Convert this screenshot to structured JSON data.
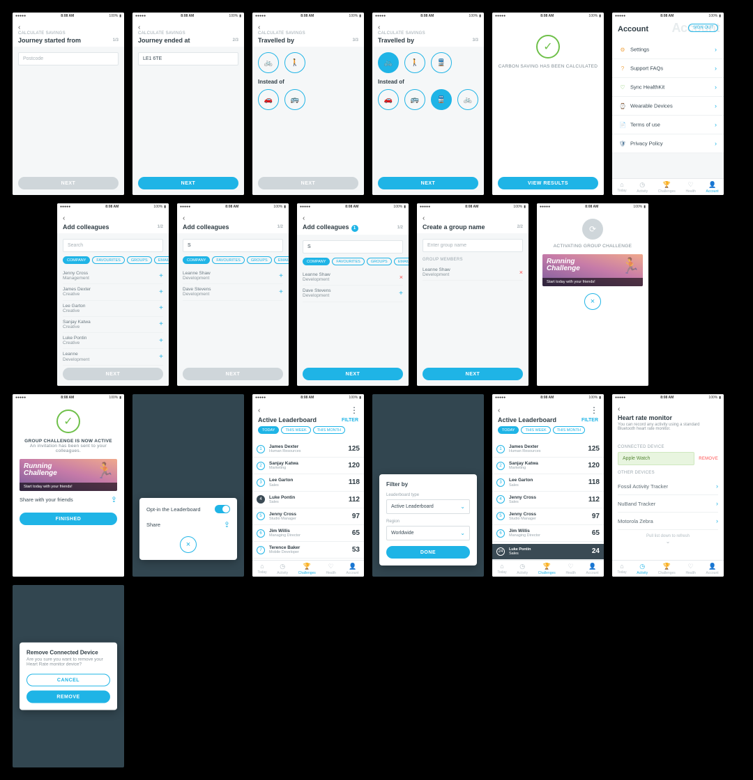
{
  "status": {
    "carrier": "•••••",
    "signal": "●●●●●",
    "wifi": "◉",
    "time": "8:08 AM",
    "battery": "100%",
    "batt_icon": "▬"
  },
  "common": {
    "next": "NEXT",
    "view_results": "VIEW RESULTS",
    "done": "DONE",
    "finished": "FINISHED",
    "cancel": "CANCEL",
    "remove": "REMOVE",
    "filter": "FILTER"
  },
  "calc": {
    "section": "CALCULATE SAVINGS",
    "s1": {
      "title": "Journey started from",
      "step": "1/3",
      "placeholder": "Postcode"
    },
    "s2": {
      "title": "Journey ended at",
      "step": "2/3",
      "value": "LE1 6TE"
    },
    "s3": {
      "title": "Travelled by",
      "step": "3/3",
      "instead": "Instead of"
    },
    "confirm": {
      "msg": "CARBON SAVING HAS BEEN CALCULATED"
    }
  },
  "account": {
    "title": "Account",
    "signout": "SIGN OUT",
    "items": [
      {
        "icon": "⚙",
        "label": "Settings",
        "color": "#f0a94e"
      },
      {
        "icon": "?",
        "label": "Support FAQs",
        "color": "#f0a94e"
      },
      {
        "icon": "♡",
        "label": "Sync HealthKit",
        "color": "#6fc04a"
      },
      {
        "icon": "⌚",
        "label": "Wearable Devices",
        "color": "#d87fe0"
      },
      {
        "icon": "📄",
        "label": "Terms of use",
        "color": "#e05f8a"
      },
      {
        "icon": "🛡",
        "label": "Privacy Policy",
        "color": "#5a7f9e"
      }
    ],
    "tabs": [
      "Today",
      "Activity",
      "Challenges",
      "Health",
      "Account"
    ]
  },
  "coll": {
    "title": "Add colleagues",
    "step": "1/2",
    "search_ph": "Search",
    "search_val": "S",
    "pills": [
      "COMPANY",
      "FAVOURITES",
      "GROUPS",
      "EMAIL"
    ],
    "list_a": [
      {
        "n": "Jenny Cross",
        "d": "Management"
      },
      {
        "n": "James Dexter",
        "d": "Creative"
      },
      {
        "n": "Lee Garton",
        "d": "Creative"
      },
      {
        "n": "Sanjay Katwa",
        "d": "Creative"
      },
      {
        "n": "Luke Pontin",
        "d": "Creative"
      },
      {
        "n": "Leanne",
        "d": "Development"
      }
    ],
    "list_b": [
      {
        "n": "Leanne Shaw",
        "d": "Development"
      },
      {
        "n": "Dave Stevens",
        "d": "Development"
      }
    ],
    "badge": "1",
    "list_c": [
      {
        "n": "Leanne Shaw",
        "d": "Development",
        "rm": true
      },
      {
        "n": "Dave Stevens",
        "d": "Development"
      }
    ]
  },
  "group": {
    "title": "Create a group name",
    "step": "2/2",
    "placeholder": "Enter group name",
    "members_label": "GROUP MEMBERS",
    "member": {
      "n": "Leanne Shaw",
      "d": "Development"
    }
  },
  "activating": {
    "title": "ACTIVATING GROUP CHALLENGE",
    "banner_t1": "Running",
    "banner_t2": "Challenge",
    "banner_sub": "Start today with your friends!"
  },
  "active": {
    "title": "GROUP CHALLENGE IS NOW ACTIVE",
    "sub": "An invitation has been sent to your colleagues.",
    "share": "Share with your friends"
  },
  "optin": {
    "title": "Opt-in the Leaderboard",
    "share": "Share"
  },
  "lb": {
    "title": "Active Leaderboard",
    "tabs": [
      "TODAY",
      "THIS WEEK",
      "THIS MONTH"
    ],
    "rows": [
      {
        "r": 1,
        "n": "James Dexter",
        "d": "Human Resources",
        "p": 125
      },
      {
        "r": 2,
        "n": "Sanjay Katwa",
        "d": "Marketing",
        "p": 120
      },
      {
        "r": 3,
        "n": "Lee Garton",
        "d": "Sales",
        "p": 118
      },
      {
        "r": 4,
        "n": "Luke Pontin",
        "d": "Sales",
        "p": 112
      },
      {
        "r": 5,
        "n": "Jenny Cross",
        "d": "Studio Manager",
        "p": 97
      },
      {
        "r": 6,
        "n": "Jim Willis",
        "d": "Managing Director",
        "p": 65
      },
      {
        "r": 7,
        "n": "Terence Baker",
        "d": "Mobile Developer",
        "p": 53
      }
    ],
    "rows2": [
      {
        "r": 1,
        "n": "James Dexter",
        "d": "Human Resources",
        "p": 125
      },
      {
        "r": 2,
        "n": "Sanjay Katwa",
        "d": "Marketing",
        "p": 120
      },
      {
        "r": 3,
        "n": "Lee Garton",
        "d": "Sales",
        "p": 118
      },
      {
        "r": 4,
        "n": "Jenny Cross",
        "d": "Sales",
        "p": 112
      },
      {
        "r": 5,
        "n": "Jenny Cross",
        "d": "Studio Manager",
        "p": 97
      },
      {
        "r": 6,
        "n": "Jim Willis",
        "d": "Managing Director",
        "p": 65
      }
    ],
    "self": {
      "r": 24,
      "n": "Luke Pontin",
      "d": "Sales",
      "p": 24
    }
  },
  "filter": {
    "title": "Filter by",
    "type_lbl": "Leaderboard type",
    "type_val": "Active Leaderboard",
    "region_lbl": "Region",
    "region_val": "Worldwide"
  },
  "hrm": {
    "title": "Heart rate monitor",
    "desc": "You can record any activity using a standard Bluetooth heart rate monitor.",
    "connected_lbl": "CONNECTED DEVICE",
    "connected": "Apple Watch",
    "remove": "REMOVE",
    "other_lbl": "OTHER DEVICES",
    "devices": [
      "Fossil Activity Tracker",
      "NuBand Tracker",
      "Motorola Zebra"
    ],
    "hint": "Pull list down to refresh"
  },
  "remove_modal": {
    "title": "Remove Connected Device",
    "body": "Are you sure you want to remove your Heart Rate monitor device?"
  }
}
